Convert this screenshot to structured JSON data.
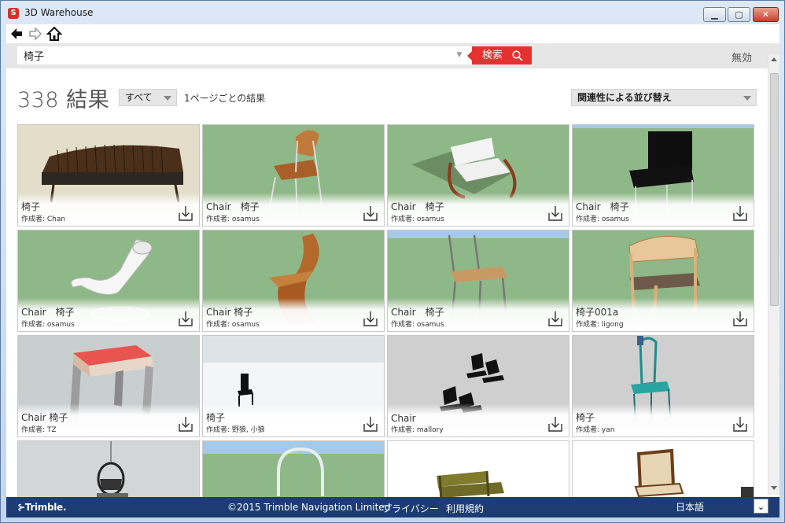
{
  "window": {
    "title": "3D Warehouse",
    "min_label": "▁",
    "max_label": "▢",
    "close_label": "✕"
  },
  "search": {
    "value": "椅子",
    "button_label": "検索",
    "disable_label": "無効"
  },
  "results": {
    "count_label": "338 結果",
    "filter_value": "すべて",
    "per_page_label": "1ページごとの結果",
    "sort_value": "関連性による並び替え"
  },
  "colors": {
    "search_red": "#e5312f",
    "footer_blue": "#1c3c73",
    "sketch_green": "#8fb888"
  },
  "cards": [
    {
      "title": "椅子",
      "author": "作成者: Chan"
    },
    {
      "title": "Chair　椅子",
      "author": "作成者: osamus"
    },
    {
      "title": "Chair　椅子",
      "author": "作成者: osamus"
    },
    {
      "title": "Chair　椅子",
      "author": "作成者: osamus"
    },
    {
      "title": "Chair　椅子",
      "author": "作成者: osamus"
    },
    {
      "title": "Chair 椅子",
      "author": "作成者: osamus"
    },
    {
      "title": "Chair　椅子",
      "author": "作成者: osamus"
    },
    {
      "title": "椅子001a",
      "author": "作成者: ligong"
    },
    {
      "title": "Chair 椅子",
      "author": "作成者: TZ"
    },
    {
      "title": "椅子",
      "author": "作成者: 野狼, 小狼"
    },
    {
      "title": "Chair",
      "author": "作成者: mallory"
    },
    {
      "title": "椅子",
      "author": "作成者: yan"
    },
    {
      "title": "",
      "author": ""
    },
    {
      "title": "",
      "author": ""
    },
    {
      "title": "",
      "author": ""
    },
    {
      "title": "",
      "author": ""
    }
  ],
  "footer": {
    "logo": "⊱Trimble.",
    "copyright": "©2015 Trimble Navigation Limited",
    "privacy": "プライバシー",
    "terms": "利用規約",
    "language": "日本語",
    "lang_button": "⌄"
  }
}
